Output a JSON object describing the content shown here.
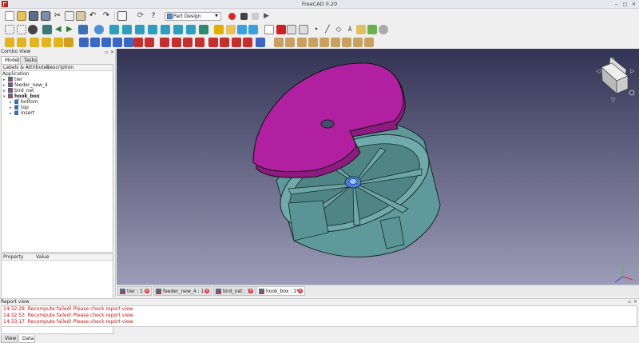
{
  "window": {
    "title": "FreeCAD 0.20"
  },
  "toolbar": {
    "workbench_selector": "Part Design"
  },
  "combo_view": {
    "title": "Combo View",
    "tabs": [
      "Model",
      "Tasks"
    ],
    "tree_headers": [
      "Labels & Attributes",
      "Description"
    ],
    "root_label": "Application",
    "items": [
      {
        "label": "tier",
        "level": 0,
        "expanded": false
      },
      {
        "label": "feeder_new_4",
        "level": 0,
        "expanded": false
      },
      {
        "label": "bird_net",
        "level": 0,
        "expanded": false
      },
      {
        "label": "hook_box",
        "level": 0,
        "expanded": true
      },
      {
        "label": "bottom",
        "level": 1,
        "expanded": false
      },
      {
        "label": "top",
        "level": 1,
        "expanded": false
      },
      {
        "label": "insert",
        "level": 1,
        "expanded": false
      }
    ],
    "property_headers": [
      "Property",
      "Value"
    ],
    "bottom_tabs": [
      "View",
      "Data"
    ]
  },
  "document_tabs": [
    {
      "label": "tier : 1"
    },
    {
      "label": "feeder_new_4 : 1"
    },
    {
      "label": "bird_net : 1"
    },
    {
      "label": "hook_box : 1*"
    }
  ],
  "report_view": {
    "title": "Report view",
    "lines": [
      {
        "time": "14:32:28",
        "message": "Recompute failed! Please check report view."
      },
      {
        "time": "14:32:53",
        "message": "Recompute failed! Please check report view."
      },
      {
        "time": "14:33:17",
        "message": "Recompute failed! Please check report view."
      }
    ]
  },
  "colors": {
    "lid": "#b020a0",
    "body": "#5f9a9a",
    "background_top": "#333355",
    "background_bottom": "#9c9cb8",
    "error_text": "#cc1111"
  }
}
